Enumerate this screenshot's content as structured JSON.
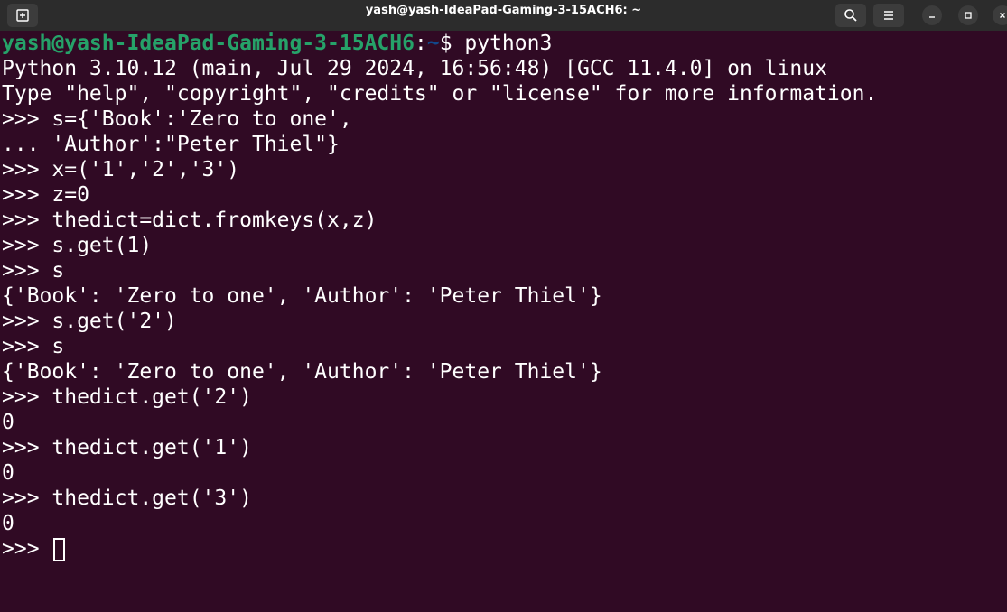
{
  "window": {
    "title": "yash@yash-IdeaPad-Gaming-3-15ACH6: ~"
  },
  "titlebar": {
    "new_tab_icon": "new-tab-icon",
    "search_icon": "search-icon",
    "menu_icon": "hamburger-menu-icon",
    "minimize_icon": "minimize-icon",
    "maximize_icon": "maximize-icon",
    "close_icon": "close-icon"
  },
  "colors": {
    "background": "#300a24",
    "prompt_user": "#26a269",
    "prompt_path": "#12488b",
    "text": "#ffffff",
    "titlebar": "#2c2c2c"
  },
  "terminal": {
    "prompt": {
      "user_host": "yash@yash-IdeaPad-Gaming-3-15ACH6",
      "separator": ":",
      "path": "~",
      "symbol": "$ ",
      "command": "python3"
    },
    "lines": [
      "Python 3.10.12 (main, Jul 29 2024, 16:56:48) [GCC 11.4.0] on linux",
      "Type \"help\", \"copyright\", \"credits\" or \"license\" for more information.",
      ">>> s={'Book':'Zero to one',",
      "... 'Author':\"Peter Thiel\"}",
      ">>> x=('1','2','3')",
      ">>> z=0",
      ">>> thedict=dict.fromkeys(x,z)",
      ">>> s.get(1)",
      ">>> s",
      "{'Book': 'Zero to one', 'Author': 'Peter Thiel'}",
      ">>> s.get('2')",
      ">>> s",
      "{'Book': 'Zero to one', 'Author': 'Peter Thiel'}",
      ">>> thedict.get('2')",
      "0",
      ">>> thedict.get('1')",
      "0",
      ">>> thedict.get('3')",
      "0"
    ],
    "final_prompt": ">>> "
  }
}
